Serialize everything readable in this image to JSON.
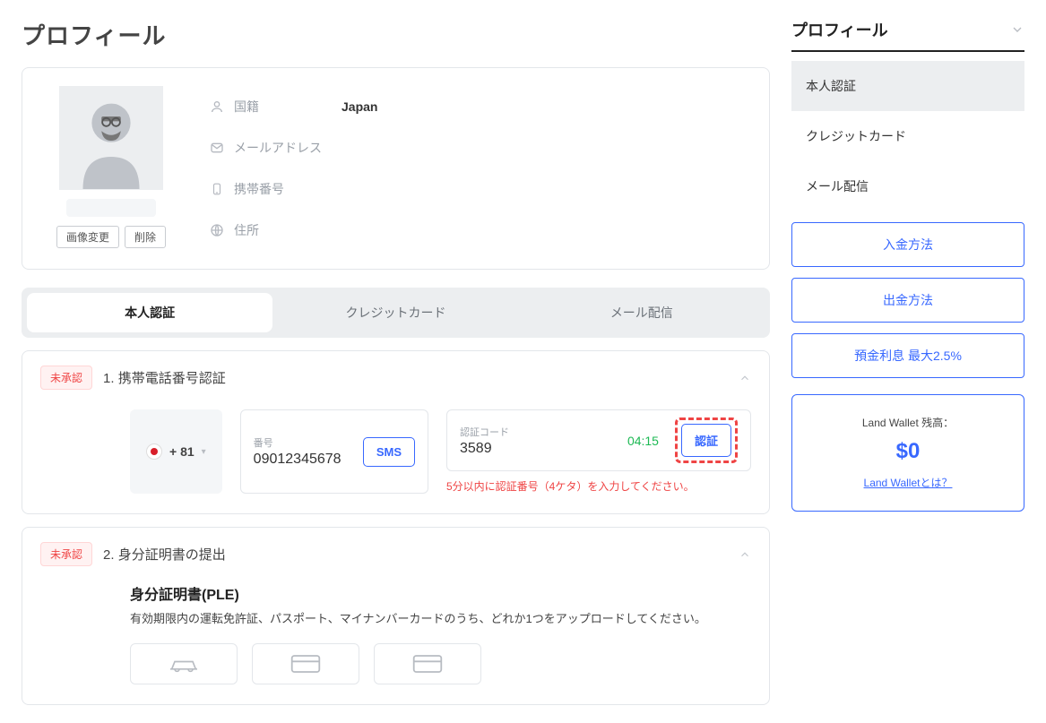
{
  "page_title": "プロフィール",
  "profile": {
    "avatar_change_btn": "画像変更",
    "avatar_delete_btn": "削除",
    "fields": {
      "nationality_label": "国籍",
      "nationality_value": "Japan",
      "email_label": "メールアドレス",
      "email_value": "",
      "phone_label": "携帯番号",
      "phone_value": "",
      "address_label": "住所",
      "address_value": ""
    }
  },
  "tabs": {
    "verify": "本人認証",
    "credit": "クレジットカード",
    "mail": "メール配信"
  },
  "section1": {
    "badge": "未承認",
    "title": "1. 携帯電話番号認証",
    "country_code": "+ 81",
    "phone_field_label": "番号",
    "phone_field_value": "09012345678",
    "sms_btn": "SMS",
    "code_field_label": "認証コード",
    "code_field_value": "3589",
    "timer": "04:15",
    "verify_btn": "認証",
    "helper": "5分以内に認証番号（4ケタ）を入力してください。"
  },
  "section2": {
    "badge": "未承認",
    "title": "2. 身分証明書の提出",
    "id_title": "身分証明書(PLE)",
    "id_desc": "有効期限内の運転免許証、パスポート、マイナンバーカードのうち、どれか1つをアップロードしてください。"
  },
  "sidebar": {
    "head": "プロフィール",
    "items": {
      "verify": "本人認証",
      "credit": "クレジットカード",
      "mail": "メール配信"
    },
    "buttons": {
      "deposit": "入金方法",
      "withdraw": "出金方法",
      "interest": "預金利息 最大2.5%"
    },
    "wallet": {
      "label": "Land Wallet 残高：",
      "amount": "$0",
      "link": "Land Walletとは？"
    }
  }
}
